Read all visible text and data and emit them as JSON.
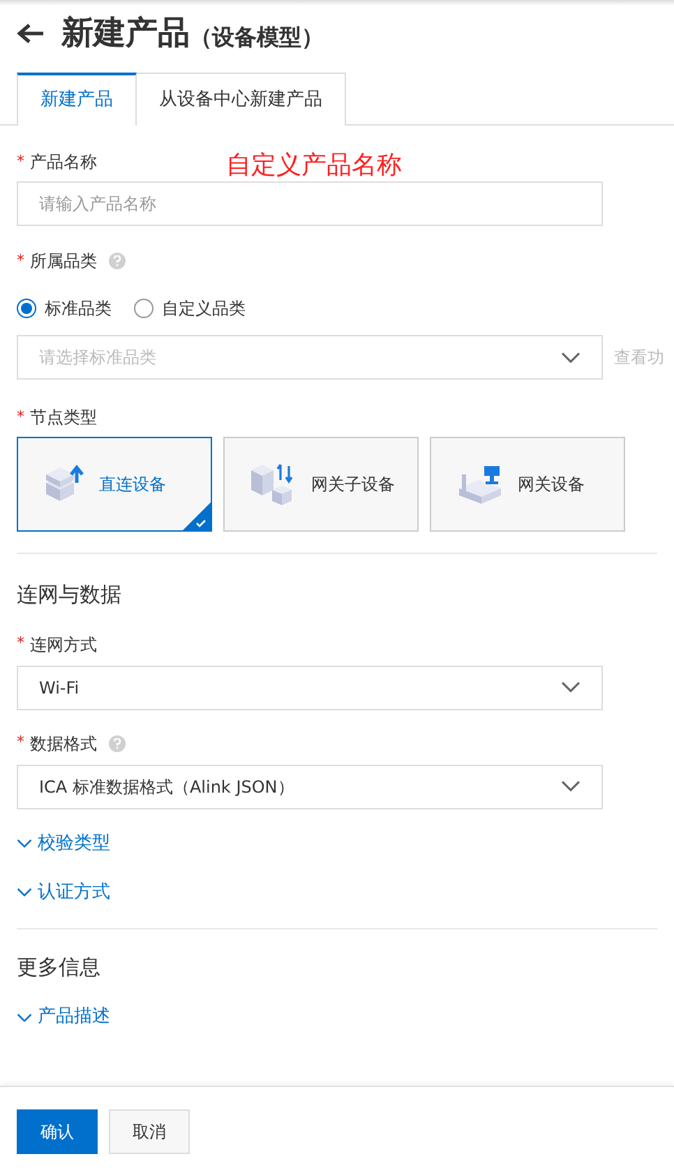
{
  "header": {
    "title": "新建产品",
    "subtitle": "（设备模型）"
  },
  "tabs": [
    {
      "label": "新建产品",
      "selected": true
    },
    {
      "label": "从设备中心新建产品",
      "selected": false
    }
  ],
  "product_name": {
    "marker": "*",
    "label": "产品名称",
    "placeholder": "请输入产品名称",
    "annotation": "自定义产品名称"
  },
  "category": {
    "marker": "*",
    "label": "所属品类",
    "help": true,
    "options": [
      {
        "label": "标准品类",
        "selected": true
      },
      {
        "label": "自定义品类",
        "selected": false
      }
    ],
    "select_placeholder": "请选择标准品类",
    "side_link": "查看功"
  },
  "node_type": {
    "marker": "*",
    "label": "节点类型",
    "options": [
      {
        "label": "直连设备",
        "kind": "direct",
        "selected": true
      },
      {
        "label": "网关子设备",
        "kind": "subdevice",
        "selected": false
      },
      {
        "label": "网关设备",
        "kind": "gateway",
        "selected": false
      }
    ]
  },
  "network_section": {
    "title": "连网与数据",
    "fields": [
      {
        "marker": "*",
        "label": "连网方式",
        "help": false,
        "value": "Wi-Fi"
      },
      {
        "marker": "*",
        "label": "数据格式",
        "help": true,
        "value": "ICA 标准数据格式（Alink JSON）"
      }
    ],
    "expanders": [
      {
        "label": "校验类型",
        "expanded": false
      },
      {
        "label": "认证方式",
        "expanded": false
      }
    ]
  },
  "more_section": {
    "title": "更多信息",
    "expanders": [
      {
        "label": "产品描述",
        "expanded": false
      }
    ]
  },
  "buttons": [
    {
      "label": "确认",
      "kind": "primary"
    },
    {
      "label": "取消",
      "kind": "secondary"
    }
  ]
}
